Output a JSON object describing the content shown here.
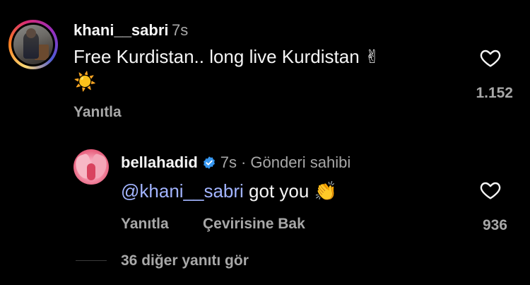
{
  "comment": {
    "username": "khani__sabri",
    "time": "7s",
    "text_line1": "Free Kurdistan.. long live Kurdistan ✌",
    "text_line2": "☀️",
    "like_count": "1.152",
    "reply_label": "Yanıtla"
  },
  "reply": {
    "username": "bellahadid",
    "time": "7s",
    "separator": "·",
    "author_badge": "Gönderi sahibi",
    "mention": "@khani__sabri",
    "text": " got you 👏",
    "like_count": "936",
    "reply_label": "Yanıtla",
    "translate_label": "Çevirisine Bak"
  },
  "more_replies": "36 diğer yanıtı gör",
  "colors": {
    "background": "#000000",
    "text": "#f5f5f5",
    "muted": "#a8a8a8",
    "mention": "#a2b4ff",
    "verified": "#3797f0"
  }
}
